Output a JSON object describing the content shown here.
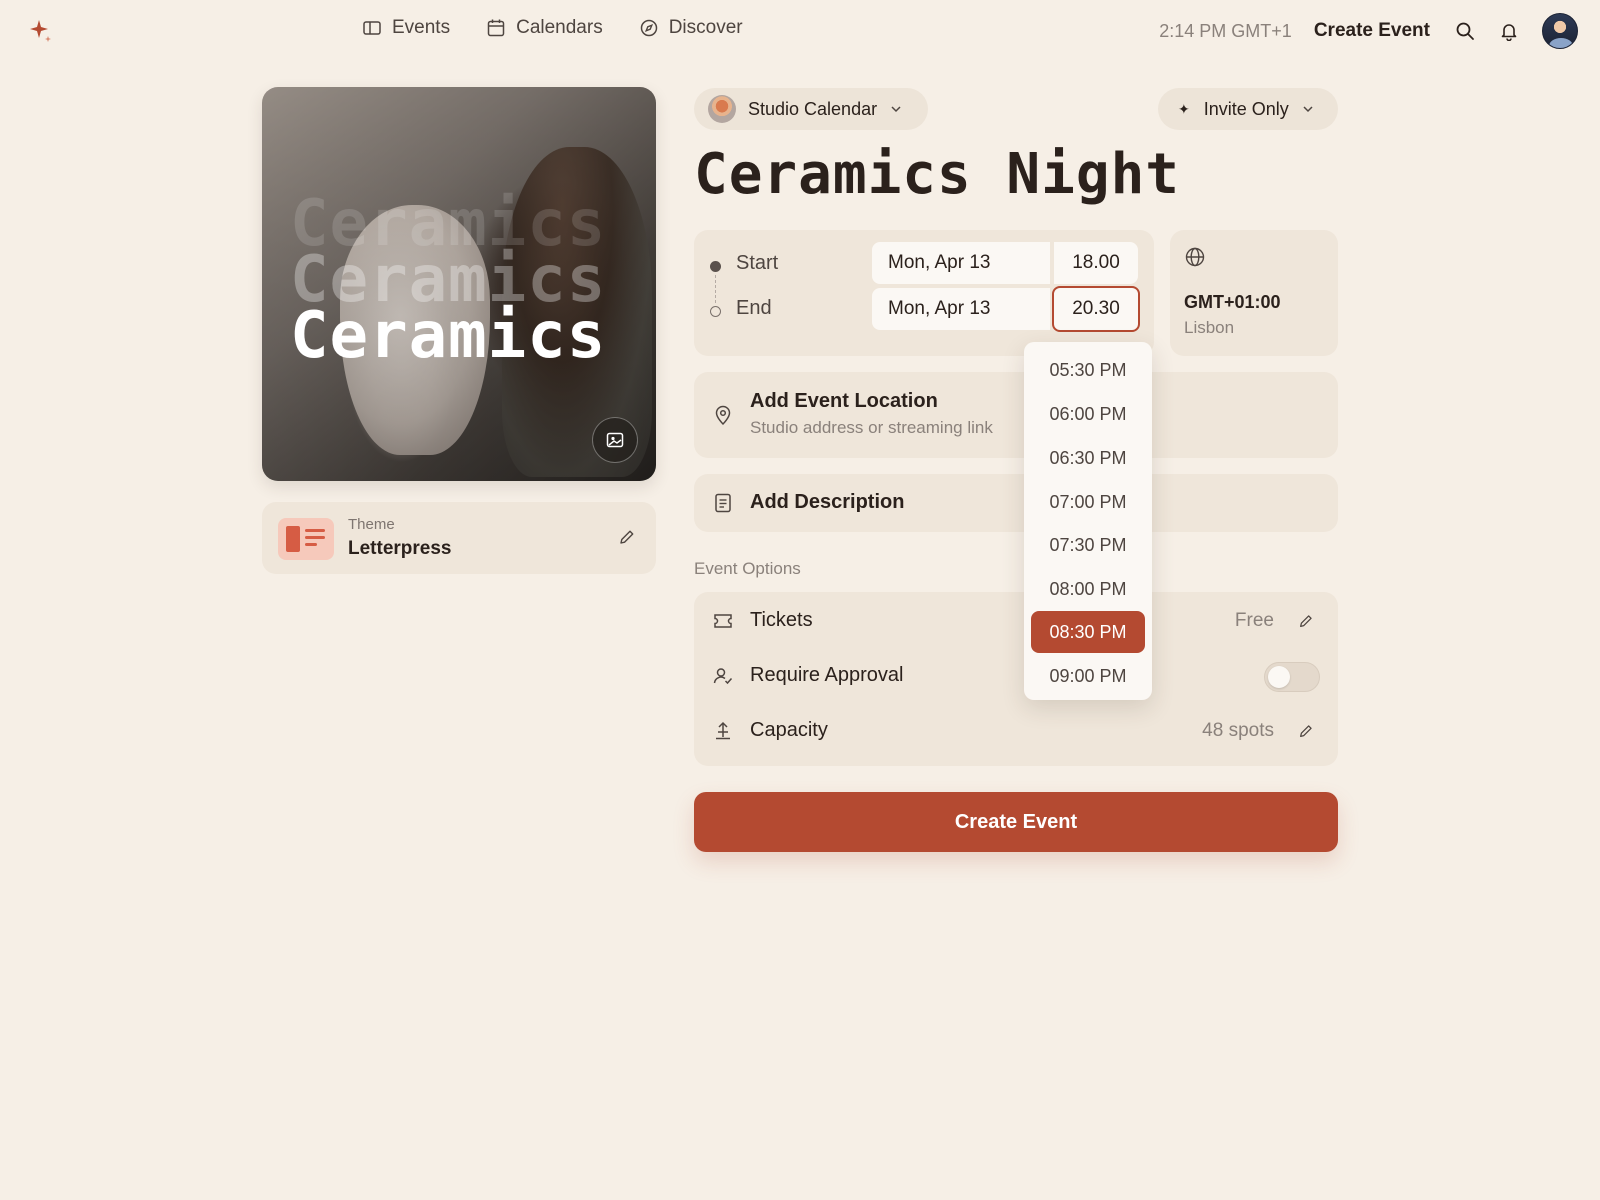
{
  "nav": {
    "items": [
      {
        "label": "Events",
        "icon": "ticket-icon"
      },
      {
        "label": "Calendars",
        "icon": "calendar-icon"
      },
      {
        "label": "Discover",
        "icon": "compass-icon"
      }
    ],
    "clock": "2:14 PM GMT+1",
    "create_label": "Create Event"
  },
  "cover": {
    "word": "Ceramics"
  },
  "theme": {
    "caption": "Theme",
    "name": "Letterpress"
  },
  "calendar_select": {
    "label": "Studio Calendar"
  },
  "visibility_select": {
    "label": "Invite Only"
  },
  "event": {
    "title": "Ceramics Night"
  },
  "schedule": {
    "start": {
      "label": "Start",
      "date": "Mon, Apr 13",
      "time": "18.00"
    },
    "end": {
      "label": "End",
      "date": "Mon, Apr 13",
      "time": "20.30"
    }
  },
  "timezone": {
    "offset": "GMT+01:00",
    "city": "Lisbon"
  },
  "location": {
    "title": "Add Event Location",
    "subtitle": "Studio address or streaming link"
  },
  "description": {
    "title": "Add Description"
  },
  "options": {
    "heading": "Event Options",
    "tickets": {
      "label": "Tickets",
      "value": "Free"
    },
    "approval": {
      "label": "Require Approval",
      "enabled": false
    },
    "capacity": {
      "label": "Capacity",
      "value": "48 spots"
    }
  },
  "create_button": "Create Event",
  "time_dropdown": {
    "options": [
      "05:30 PM",
      "06:00 PM",
      "06:30 PM",
      "07:00 PM",
      "07:30 PM",
      "08:00 PM",
      "08:30 PM",
      "09:00 PM"
    ],
    "selected": "08:30 PM"
  },
  "colors": {
    "accent": "#b44a31",
    "background": "#f6efe6",
    "card": "#efe6da"
  }
}
